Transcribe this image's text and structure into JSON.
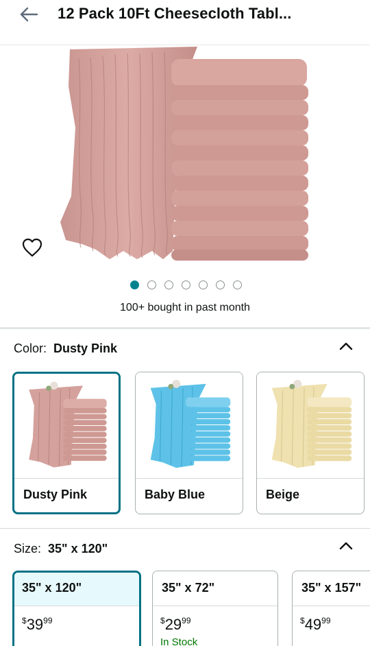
{
  "header": {
    "title": "12 Pack 10Ft Cheesecloth Tabl...",
    "back_icon": "back-arrow-icon"
  },
  "hero": {
    "carousel_count": 7,
    "carousel_active_index": 0,
    "bought_text": "100+ bought in past month",
    "favorite_icon": "heart-icon"
  },
  "color": {
    "label": "Color:",
    "selected": "Dusty Pink",
    "options": [
      {
        "name": "Dusty Pink",
        "color": "#d4a19c",
        "light": "#e6bfba",
        "dark": "#b78480"
      },
      {
        "name": "Baby Blue",
        "color": "#5ec2e8",
        "light": "#9fdcf3",
        "dark": "#3aa6cf"
      },
      {
        "name": "Beige",
        "color": "#efe1b0",
        "light": "#f7efcf",
        "dark": "#d8c58d"
      }
    ]
  },
  "size": {
    "label": "Size:",
    "selected": "35\" x 120\"",
    "options": [
      {
        "name": "35\" x 120\"",
        "currency": "$",
        "dollars": "39",
        "cents": "99",
        "stock": ""
      },
      {
        "name": "35\" x 72\"",
        "currency": "$",
        "dollars": "29",
        "cents": "99",
        "stock": "In Stock"
      },
      {
        "name": "35\" x 157\"",
        "currency": "$",
        "dollars": "49",
        "cents": "99",
        "stock": ""
      }
    ]
  },
  "colors": {
    "accent": "#007185",
    "dot_active": "#00838f",
    "in_stock": "#007600",
    "selected_bg": "#e6f9fc"
  }
}
